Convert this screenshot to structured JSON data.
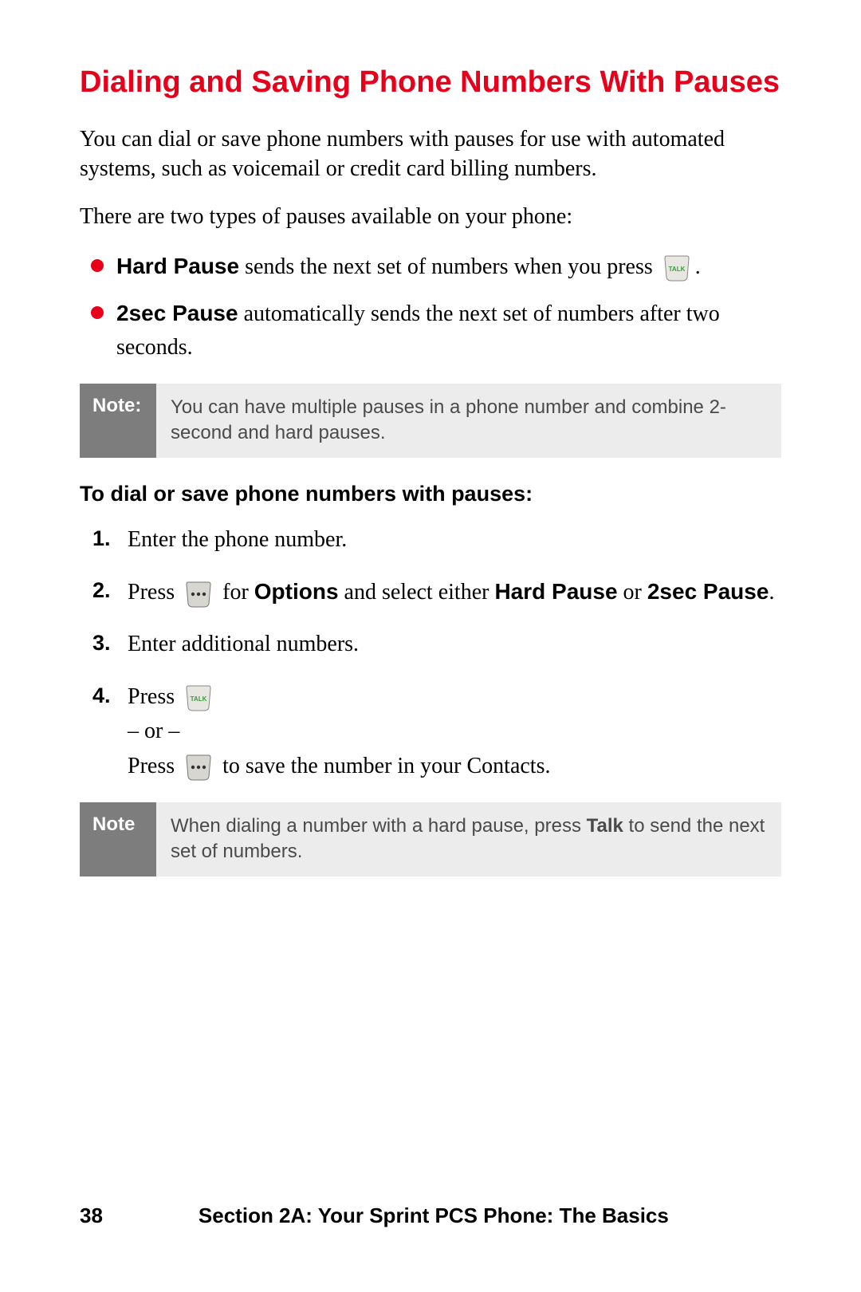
{
  "title": "Dialing and Saving Phone Numbers With Pauses",
  "intro1": "You can dial or save phone numbers with pauses for use with automated systems, such as voicemail or credit card billing numbers.",
  "intro2": "There are two types of pauses available on your phone:",
  "bullets": {
    "hard_label": "Hard Pause",
    "hard_text_a": " sends the next set of numbers when you press ",
    "hard_text_b": ".",
    "sec_label": "2sec Pause",
    "sec_text": " automatically sends the next set of numbers after two seconds."
  },
  "note1": {
    "label": "Note:",
    "text": "You can have multiple pauses in a phone number and combine 2-second and hard pauses."
  },
  "subhead": "To dial or save phone numbers with pauses:",
  "steps": {
    "s1_num": "1.",
    "s1": "Enter the phone number.",
    "s2_num": "2.",
    "s2_a": "Press ",
    "s2_b": " for ",
    "s2_options": "Options",
    "s2_c": " and select either ",
    "s2_hard": "Hard Pause",
    "s2_d": " or ",
    "s2_sec": "2sec Pause",
    "s2_e": ".",
    "s3_num": "3.",
    "s3": "Enter additional numbers.",
    "s4_num": "4.",
    "s4_a": "Press ",
    "s4_or": "– or –",
    "s4_b": "Press ",
    "s4_c": " to save the number in your Contacts."
  },
  "note2": {
    "label": "Note",
    "text_a": "When dialing a number with a hard pause, press ",
    "text_talk": "Talk",
    "text_b": " to send the next set of numbers."
  },
  "footer": {
    "page": "38",
    "section": "Section 2A: Your Sprint PCS Phone: The Basics"
  }
}
